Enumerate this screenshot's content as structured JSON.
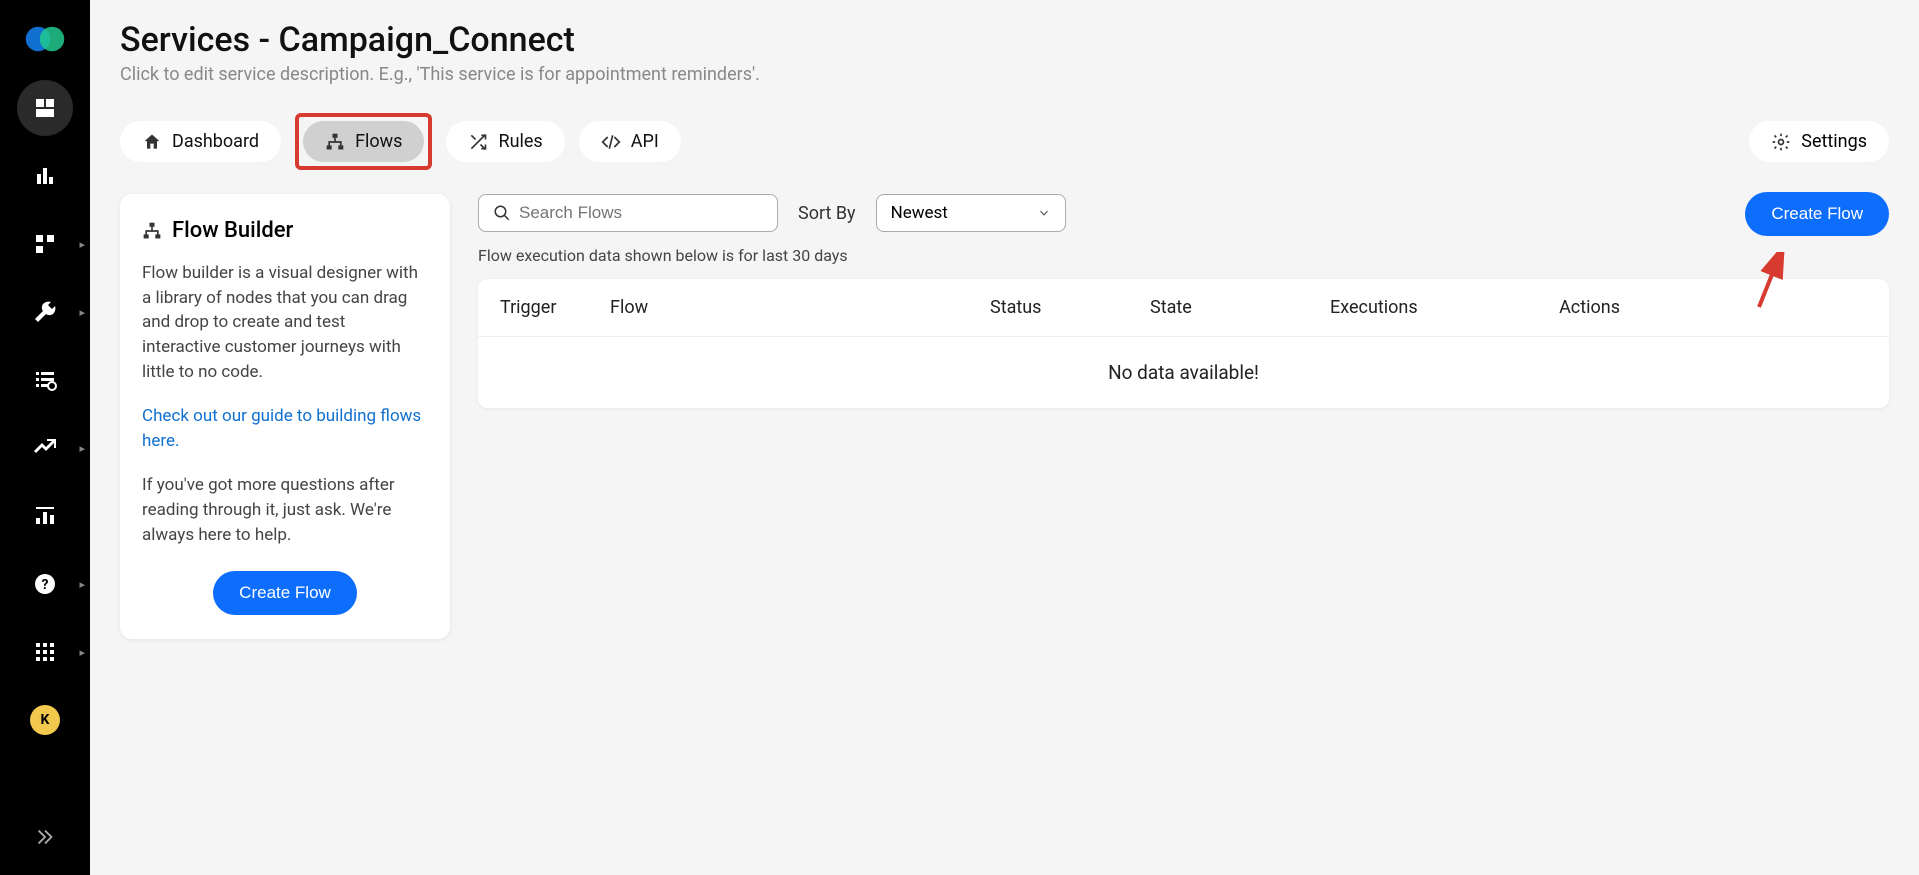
{
  "header": {
    "title": "Services - Campaign_Connect",
    "subtitle": "Click to edit service description. E.g., 'This service is for appointment reminders'."
  },
  "tabs": {
    "dashboard": "Dashboard",
    "flows": "Flows",
    "rules": "Rules",
    "api": "API",
    "settings": "Settings"
  },
  "flow_builder": {
    "title": "Flow Builder",
    "body": "Flow builder is a visual designer with a library of nodes that you can drag and drop to create and test interactive customer journeys with little to no code.",
    "guide_link": "Check out our guide to building flows here.",
    "help": "If you've got more questions after reading through it, just ask. We're always here to help.",
    "create_btn": "Create Flow"
  },
  "flow_area": {
    "search_placeholder": "Search Flows",
    "sort_label": "Sort By",
    "sort_value": "Newest",
    "create_btn": "Create Flow",
    "note": "Flow execution data shown below is for last 30 days",
    "columns": {
      "trigger": "Trigger",
      "flow": "Flow",
      "status": "Status",
      "state": "State",
      "executions": "Executions",
      "actions": "Actions"
    },
    "empty": "No data available!"
  },
  "avatar_letter": "K"
}
